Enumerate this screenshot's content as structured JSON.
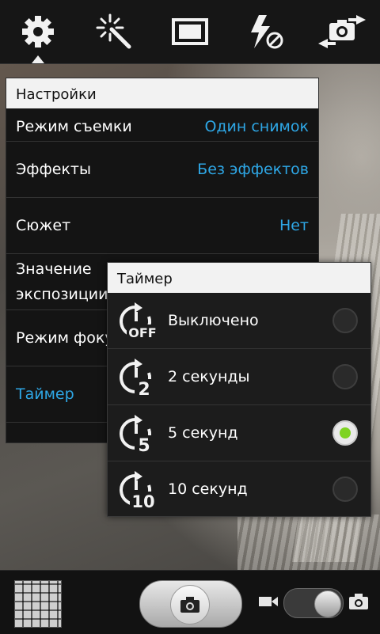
{
  "toolbar": {
    "items": [
      {
        "icon": "gear-icon"
      },
      {
        "icon": "magic-wand-icon"
      },
      {
        "icon": "display-mode-icon"
      },
      {
        "icon": "flash-off-icon"
      },
      {
        "icon": "switch-camera-icon"
      }
    ]
  },
  "settings": {
    "title": "Настройки",
    "rows": [
      {
        "label": "Режим съемки",
        "value": "Один снимок"
      },
      {
        "label": "Эффекты",
        "value": "Без эффектов"
      },
      {
        "label": "Сюжет",
        "value": "Нет"
      },
      {
        "label": "Значение экспозиции",
        "value": ""
      },
      {
        "label": "Режим фокусировки",
        "value": ""
      },
      {
        "label": "Таймер",
        "value": ""
      }
    ]
  },
  "timer": {
    "title": "Таймер",
    "options": [
      {
        "label": "Выключено",
        "icon_text": "OFF",
        "selected": false
      },
      {
        "label": "2 секунды",
        "icon_text": "2",
        "selected": false
      },
      {
        "label": "5 секунд",
        "icon_text": "5",
        "selected": true
      },
      {
        "label": "10 секунд",
        "icon_text": "10",
        "selected": false
      }
    ]
  },
  "bottombar": {
    "mode": "photo"
  },
  "colors": {
    "accent": "#2ea7e6",
    "radio_selected": "#7ed321"
  }
}
